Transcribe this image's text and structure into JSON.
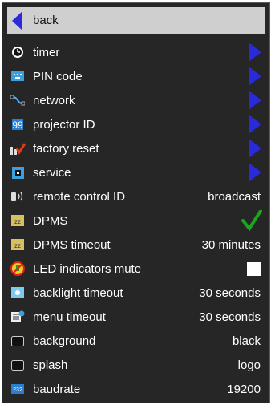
{
  "menu": {
    "back_label": "back",
    "items": [
      {
        "label": "timer",
        "icon": "clock-icon",
        "kind": "submenu"
      },
      {
        "label": "PIN code",
        "icon": "keypad-icon",
        "kind": "submenu"
      },
      {
        "label": "network",
        "icon": "network-cable-icon",
        "kind": "submenu"
      },
      {
        "label": "projector ID",
        "icon": "id-quote-icon",
        "kind": "submenu"
      },
      {
        "label": "factory reset",
        "icon": "factory-reset-icon",
        "kind": "submenu"
      },
      {
        "label": "service",
        "icon": "service-chip-icon",
        "kind": "submenu"
      },
      {
        "label": "remote control ID",
        "value": "broadcast",
        "icon": "remote-icon",
        "kind": "value"
      },
      {
        "label": "DPMS",
        "icon": "dpms-icon",
        "kind": "checked"
      },
      {
        "label": "DPMS timeout",
        "value": "30 minutes",
        "icon": "dpms-timeout-icon",
        "kind": "value"
      },
      {
        "label": "LED indicators mute",
        "icon": "led-mute-icon",
        "kind": "unchecked"
      },
      {
        "label": "backlight timeout",
        "value": "30 seconds",
        "icon": "backlight-icon",
        "kind": "value"
      },
      {
        "label": "menu timeout",
        "value": "30 seconds",
        "icon": "menu-timeout-icon",
        "kind": "value"
      },
      {
        "label": "background",
        "value": "black",
        "icon": "background-icon",
        "kind": "value"
      },
      {
        "label": "splash",
        "value": "logo",
        "icon": "splash-icon",
        "kind": "value"
      },
      {
        "label": "baudrate",
        "value": "19200",
        "icon": "baudrate-232-icon",
        "kind": "value"
      }
    ]
  },
  "colors": {
    "panel_bg": "#262626",
    "back_row_bg": "#cfcfcf",
    "arrow_blue": "#2a2ad8",
    "check_green": "#1aa51a"
  }
}
